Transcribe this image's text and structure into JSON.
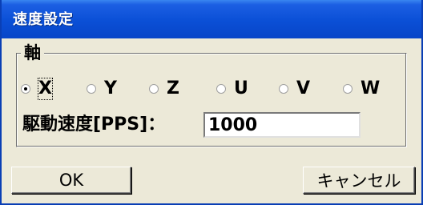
{
  "window": {
    "title": "速度設定"
  },
  "axis_group": {
    "label": "軸",
    "options": [
      {
        "label": "X",
        "checked": true
      },
      {
        "label": "Y",
        "checked": false
      },
      {
        "label": "Z",
        "checked": false
      },
      {
        "label": "U",
        "checked": false
      },
      {
        "label": "V",
        "checked": false
      },
      {
        "label": "W",
        "checked": false
      }
    ]
  },
  "speed": {
    "label": "駆動速度[PPS]：",
    "value": "1000"
  },
  "buttons": {
    "ok_label": "OK",
    "cancel_label": "キャンセル"
  },
  "colors": {
    "titlebar": "#0a4fd6",
    "dialog_bg": "#ece9d8"
  }
}
